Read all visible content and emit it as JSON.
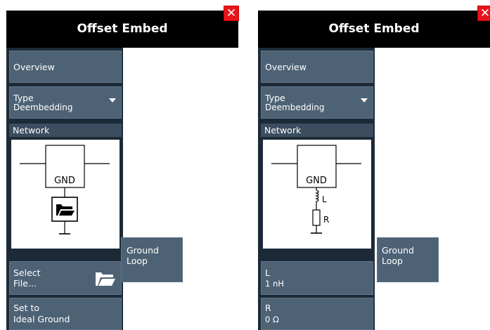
{
  "left_panel": {
    "title": "Offset Embed",
    "close_glyph": "✕",
    "overview_label": "Overview",
    "type_label": "Type",
    "type_value": "Deembedding",
    "network_label": "Network",
    "diagram": {
      "gnd_label": "GND"
    },
    "select_file_line1": "Select",
    "select_file_line2": "File...",
    "set_ideal_line1": "Set to",
    "set_ideal_line2": "Ideal Ground",
    "ground_loop_line1": "Ground",
    "ground_loop_line2": "Loop"
  },
  "right_panel": {
    "title": "Offset Embed",
    "close_glyph": "✕",
    "overview_label": "Overview",
    "type_label": "Type",
    "type_value": "Deembedding",
    "network_label": "Network",
    "diagram": {
      "gnd_label": "GND",
      "inductor_label": "L",
      "resistor_label": "R"
    },
    "l_label": "L",
    "l_value": "1 nH",
    "r_label": "R",
    "r_value": "0 Ω",
    "ground_loop_line1": "Ground",
    "ground_loop_line2": "Loop"
  },
  "colors": {
    "title_bar": "#000000",
    "button": "#4e6275",
    "panel_bg": "#1c2a37",
    "close": "#e8141c"
  }
}
